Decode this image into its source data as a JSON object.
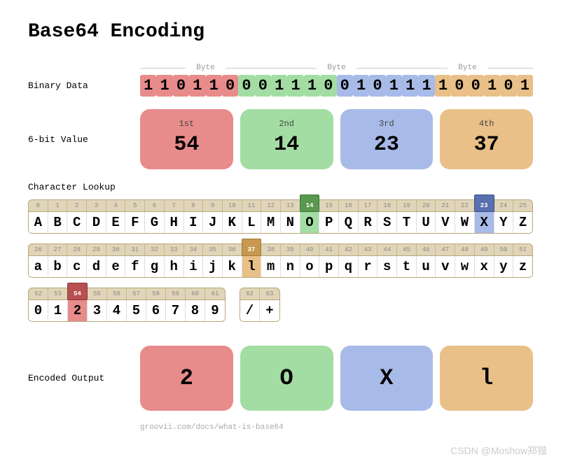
{
  "title": "Base64 Encoding",
  "labels": {
    "binary": "Binary Data",
    "sixbit": "6-bit Value",
    "lookup": "Character Lookup",
    "output": "Encoded Output",
    "byte": "Byte"
  },
  "binary": {
    "groups": [
      {
        "color": "r",
        "bits": [
          "1",
          "1",
          "0",
          "1",
          "1",
          "0"
        ]
      },
      {
        "color": "g",
        "bits": [
          "0",
          "0",
          "1",
          "1",
          "1",
          "0"
        ]
      },
      {
        "color": "b",
        "bits": [
          "0",
          "1",
          "0",
          "1",
          "1",
          "1"
        ]
      },
      {
        "color": "o",
        "bits": [
          "1",
          "0",
          "0",
          "1",
          "0",
          "1"
        ]
      }
    ]
  },
  "sixbit": [
    {
      "ord": "1st",
      "val": "54",
      "color": "r"
    },
    {
      "ord": "2nd",
      "val": "14",
      "color": "g"
    },
    {
      "ord": "3rd",
      "val": "23",
      "color": "b"
    },
    {
      "ord": "4th",
      "val": "37",
      "color": "o"
    }
  ],
  "lookup": {
    "rows": [
      {
        "start": 0,
        "chars": [
          "A",
          "B",
          "C",
          "D",
          "E",
          "F",
          "G",
          "H",
          "I",
          "J",
          "K",
          "L",
          "M",
          "N",
          "O",
          "P",
          "Q",
          "R",
          "S",
          "T",
          "U",
          "V",
          "W",
          "X",
          "Y",
          "Z"
        ],
        "hl": {
          "14": "g",
          "23": "b"
        }
      },
      {
        "start": 26,
        "chars": [
          "a",
          "b",
          "c",
          "d",
          "e",
          "f",
          "g",
          "h",
          "i",
          "j",
          "k",
          "l",
          "m",
          "n",
          "o",
          "p",
          "q",
          "r",
          "s",
          "t",
          "u",
          "v",
          "w",
          "x",
          "y",
          "z"
        ],
        "hl": {
          "37": "o"
        }
      }
    ],
    "shortRows": [
      {
        "start": 52,
        "chars": [
          "0",
          "1",
          "2",
          "3",
          "4",
          "5",
          "6",
          "7",
          "8",
          "9"
        ],
        "hl": {
          "54": "r"
        }
      },
      {
        "start": 62,
        "chars": [
          "/",
          "+"
        ],
        "hl": {}
      }
    ]
  },
  "output": [
    {
      "ch": "2",
      "color": "r"
    },
    {
      "ch": "O",
      "color": "g"
    },
    {
      "ch": "X",
      "color": "b"
    },
    {
      "ch": "l",
      "color": "o"
    }
  ],
  "footer": "groovii.com/docs/what-is-base64",
  "watermark": "CSDN @Moshow郑锴"
}
